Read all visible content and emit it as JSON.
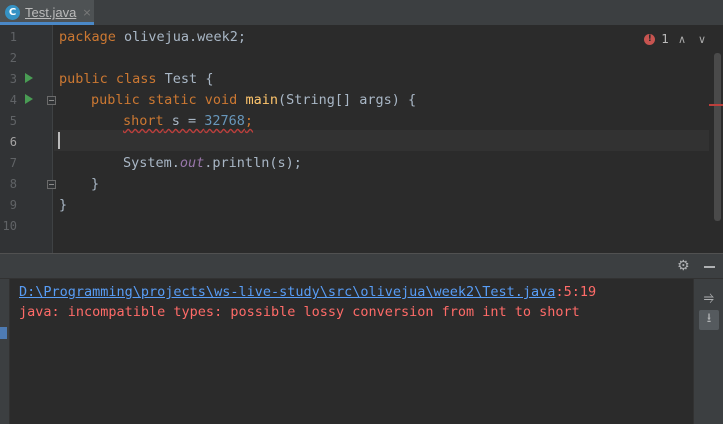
{
  "tab": {
    "label": "Test.java",
    "icon": "C",
    "close": "×"
  },
  "gutter": {
    "line_numbers": [
      "1",
      "2",
      "3",
      "4",
      "5",
      "6",
      "7",
      "8",
      "9",
      "10"
    ]
  },
  "code": {
    "l1_kw": "package",
    "l1_rest": " olivejua.week2;",
    "l3_kw": "public class",
    "l3_rest": " Test {",
    "l4_kw": "public static void",
    "l4_fn": "main",
    "l4_rest": "(String[] args) {",
    "l5_type": "short",
    "l5_mid": " s = ",
    "l5_num": "32768",
    "l5_end": ";",
    "l7_pre": "System.",
    "l7_field": "out",
    "l7_post": ".println(s);",
    "l8": "}",
    "l9": "}"
  },
  "inspection": {
    "error_count": "1",
    "error_glyph": "!",
    "prev": "∧",
    "next": "∨"
  },
  "build": {
    "path": "D:\\Programming\\projects\\ws-live-study\\src\\olivejua\\week2\\Test.java",
    "position": ":5:19",
    "message": "java: incompatible types: possible lossy conversion from int to short"
  },
  "icons": {
    "gear": "⚙",
    "soft_wrap": "⥤",
    "scroll_end": "⭳"
  },
  "colors": {
    "keyword": "#cc7832",
    "number": "#6897bb",
    "error": "#ff6b68",
    "link": "#589df6"
  }
}
